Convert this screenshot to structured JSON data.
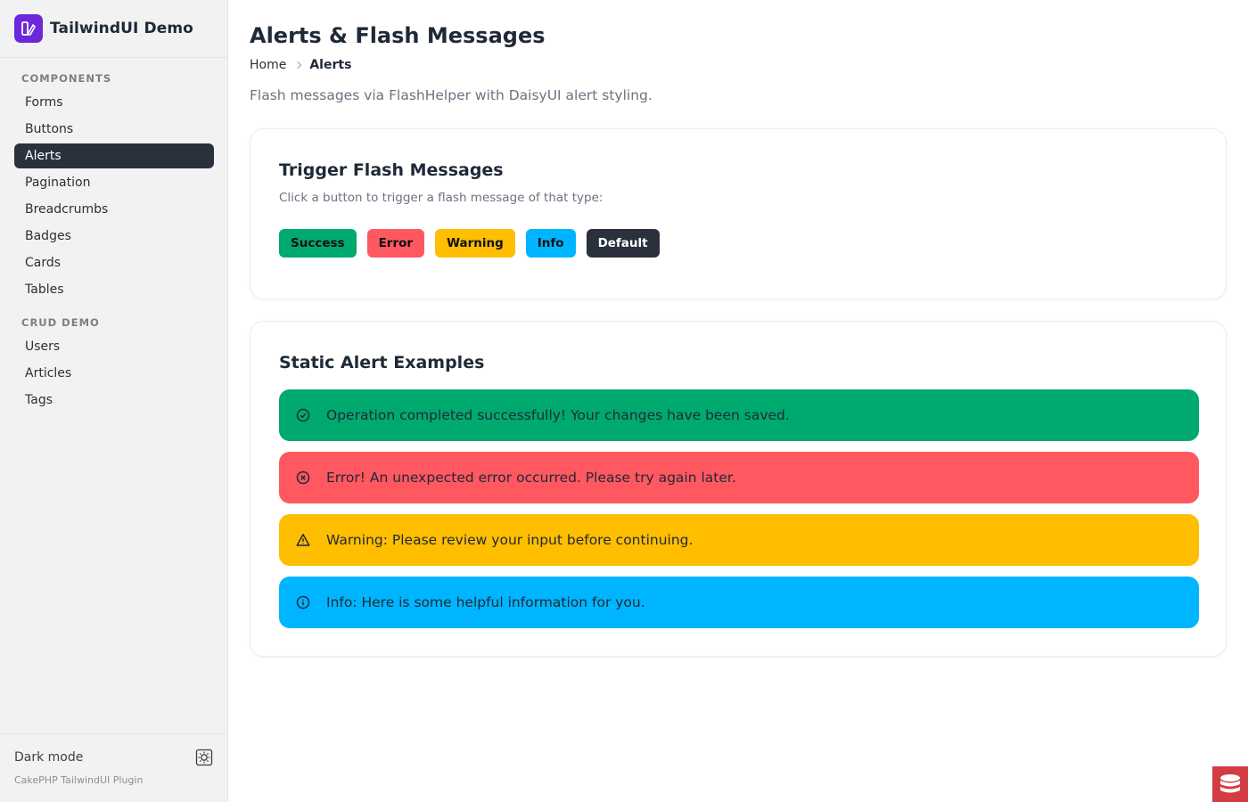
{
  "brand": {
    "name": "TailwindUI Demo",
    "logo_icon": "app-logo-icon",
    "logo_color": "#6d28d9"
  },
  "sidebar": {
    "sections": [
      {
        "title": "COMPONENTS",
        "items": [
          {
            "label": "Forms"
          },
          {
            "label": "Buttons"
          },
          {
            "label": "Alerts",
            "active": true
          },
          {
            "label": "Pagination"
          },
          {
            "label": "Breadcrumbs"
          },
          {
            "label": "Badges"
          },
          {
            "label": "Cards"
          },
          {
            "label": "Tables"
          }
        ]
      },
      {
        "title": "CRUD DEMO",
        "items": [
          {
            "label": "Users"
          },
          {
            "label": "Articles"
          },
          {
            "label": "Tags"
          }
        ]
      }
    ],
    "footer": {
      "dark_mode_label": "Dark mode",
      "toggle_icon": "sun-icon",
      "plugin_note": "CakePHP TailwindUI Plugin"
    }
  },
  "page": {
    "title": "Alerts & Flash Messages",
    "breadcrumb": {
      "home": "Home",
      "current": "Alerts"
    },
    "description": "Flash messages via FlashHelper with DaisyUI alert styling."
  },
  "trigger_card": {
    "title": "Trigger Flash Messages",
    "subtitle": "Click a button to trigger a flash message of that type:",
    "buttons": [
      {
        "label": "Success",
        "color": "#00a96e"
      },
      {
        "label": "Error",
        "color": "#ff5861"
      },
      {
        "label": "Warning",
        "color": "#ffbe00"
      },
      {
        "label": "Info",
        "color": "#00b5ff"
      },
      {
        "label": "Default",
        "color": "#2a303c"
      }
    ]
  },
  "static_card": {
    "title": "Static Alert Examples",
    "alerts": [
      {
        "type": "success",
        "icon": "check-circle-icon",
        "text": "Operation completed successfully! Your changes have been saved.",
        "color": "#00a96e"
      },
      {
        "type": "error",
        "icon": "x-circle-icon",
        "text": "Error! An unexpected error occurred. Please try again later.",
        "color": "#ff5861"
      },
      {
        "type": "warning",
        "icon": "warning-triangle-icon",
        "text": "Warning: Please review your input before continuing.",
        "color": "#ffbe00"
      },
      {
        "type": "info",
        "icon": "info-circle-icon",
        "text": "Info: Here is some helpful information for you.",
        "color": "#00b5ff"
      }
    ]
  },
  "corner_badge": {
    "icon": "cakephp-logo-icon",
    "color": "#d33c43"
  }
}
